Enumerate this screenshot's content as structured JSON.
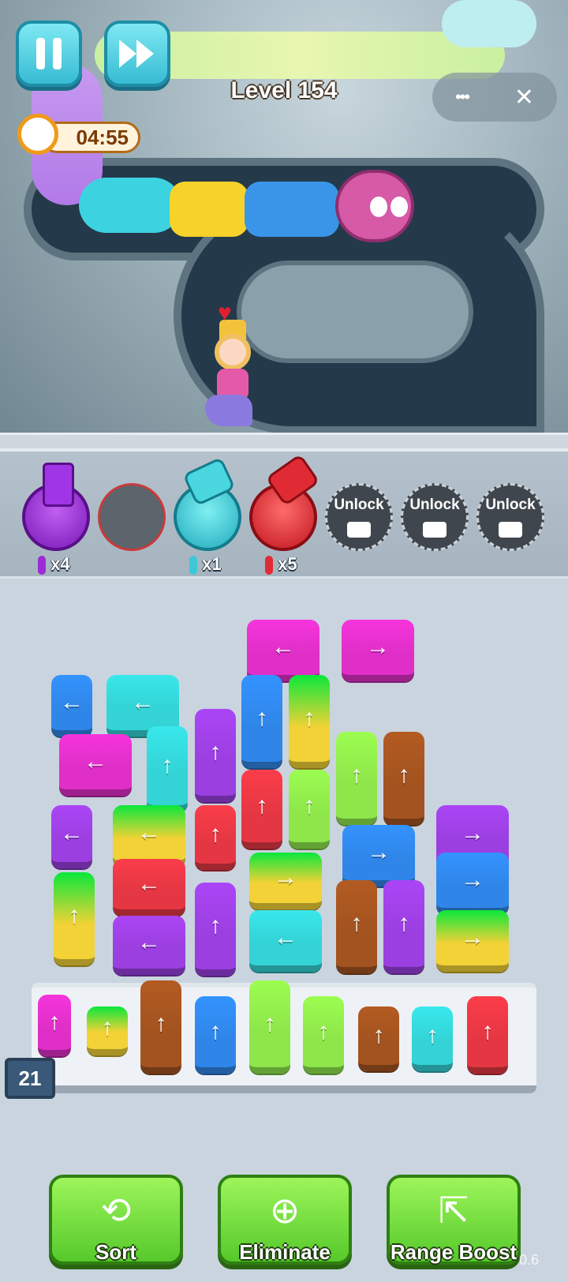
{
  "hud": {
    "level_label": "Level 154",
    "timer": "04:55",
    "pause_icon": "pause-icon",
    "fast_forward_icon": "fast-forward-icon",
    "more_label": "•••",
    "close_label": "✕"
  },
  "shooters": [
    {
      "color": "#9b2bd6",
      "count_label": "x4",
      "state": "filled"
    },
    {
      "color": "#5c646c",
      "count_label": "",
      "state": "empty"
    },
    {
      "color": "#3cc8d6",
      "count_label": "x1",
      "state": "filled"
    },
    {
      "color": "#e02b35",
      "count_label": "x5",
      "state": "filled"
    },
    {
      "label": "Unlock",
      "state": "locked"
    },
    {
      "label": "Unlock",
      "state": "locked"
    },
    {
      "label": "Unlock",
      "state": "locked"
    }
  ],
  "arrows": {
    "up": "↑",
    "left": "←",
    "right": "→"
  },
  "queue_count": "21",
  "boosters": [
    {
      "label": "Sort",
      "icon": "sort-icon"
    },
    {
      "label": "Eliminate",
      "icon": "eliminate-icon"
    },
    {
      "label": "Range Boost",
      "icon": "range-boost-icon"
    }
  ],
  "version_text": "0.6",
  "colors": {
    "magenta": "#e02fc8",
    "blue": "#2f86e8",
    "cyan": "#33d3d6",
    "purple": "#9b3fe0",
    "yellow": "#f2d236",
    "red": "#e53743",
    "green": "#8ee64a",
    "brown": "#a3531f"
  }
}
